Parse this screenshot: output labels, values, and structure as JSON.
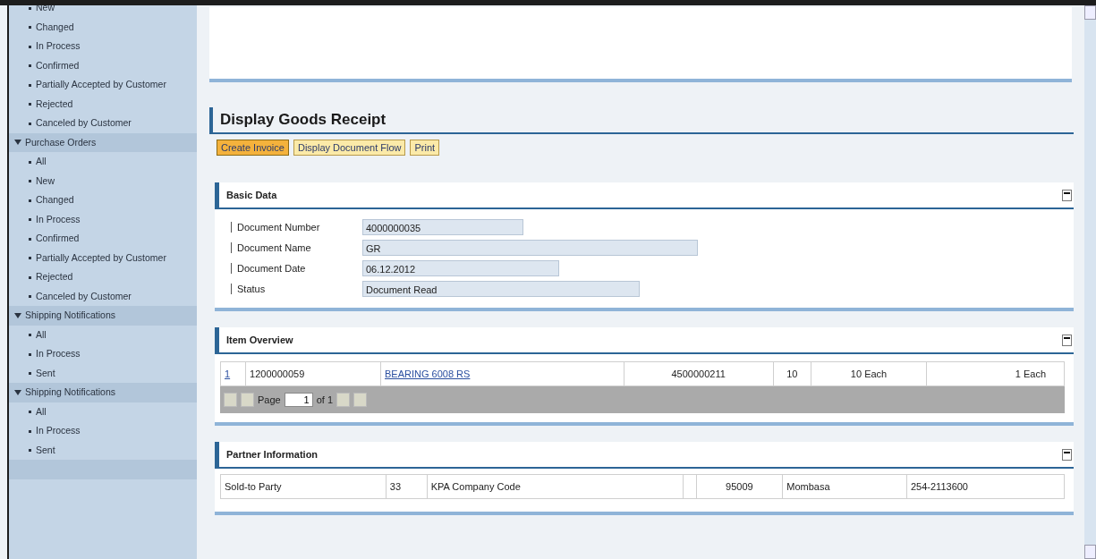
{
  "sidebar": {
    "groups": [
      {
        "items": [
          "New",
          "Changed",
          "In Process",
          "Confirmed",
          "Partially Accepted by Customer",
          "Rejected",
          "Canceled by Customer"
        ]
      },
      {
        "title": "Purchase Orders",
        "expanded": true,
        "items": [
          "All",
          "New",
          "Changed",
          "In Process",
          "Confirmed",
          "Partially Accepted by Customer",
          "Rejected",
          "Canceled by Customer"
        ]
      },
      {
        "title": "Shipping Notifications",
        "expanded": true,
        "items": [
          "All",
          "In Process",
          "Sent"
        ]
      },
      {
        "title": "Shipping Notifications",
        "expanded": true,
        "items": [
          "All",
          "In Process",
          "Sent"
        ]
      }
    ]
  },
  "page": {
    "title": "Display Goods Receipt",
    "buttons": [
      {
        "label": "Create Invoice",
        "emphasized": true
      },
      {
        "label": "Display Document Flow",
        "emphasized": false
      },
      {
        "label": "Print",
        "emphasized": false
      }
    ],
    "basic_data": {
      "title": "Basic Data",
      "fields": [
        {
          "label": "Document Number",
          "value": "4000000035"
        },
        {
          "label": "Document Name",
          "value": "GR"
        },
        {
          "label": "Document Date",
          "value": "06.12.2012"
        },
        {
          "label": "Status",
          "value": "Document Read"
        }
      ]
    },
    "item_overview": {
      "title": "Item Overview",
      "rows": [
        [
          "1",
          "1200000059",
          "BEARING 6008 RS",
          "4500000211",
          "10",
          "10 Each",
          "1 Each"
        ]
      ],
      "pager": {
        "label": "Page",
        "page": "1",
        "of": "of 1"
      }
    },
    "partner_information": {
      "title": "Partner Information",
      "rows": [
        [
          "Sold-to Party",
          "33",
          "KPA Company Code",
          "",
          "95009",
          "Mombasa",
          "254-2113600"
        ]
      ]
    }
  }
}
